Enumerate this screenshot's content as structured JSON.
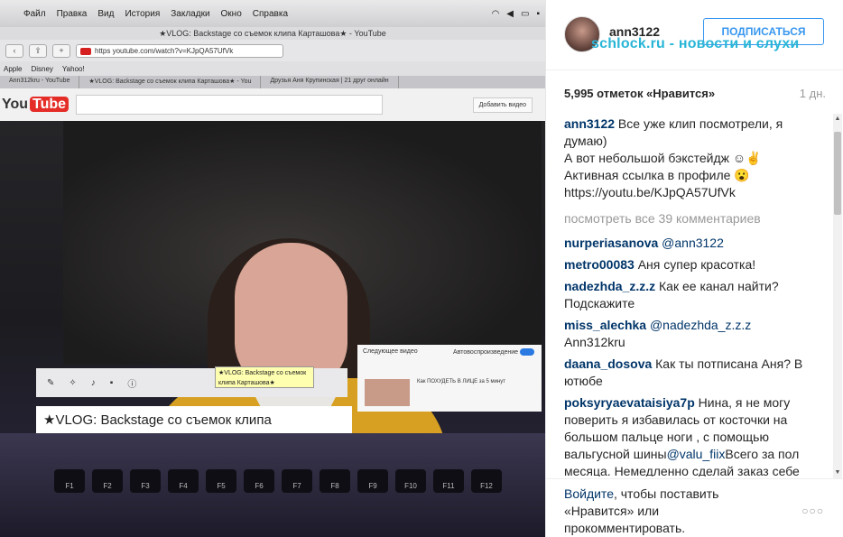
{
  "photo": {
    "menubar": [
      "Файл",
      "Правка",
      "Вид",
      "История",
      "Закладки",
      "Окно",
      "Справка"
    ],
    "window_title": "★VLOG: Backstage со съемок клипа Карташова★ - YouTube",
    "url": "https youtube.com/watch?v=KJpQA57UfVk",
    "bookmarks": [
      "Apple",
      "Disney",
      "Yahoo!"
    ],
    "tabs": [
      "Ann312kru - YouTube",
      "★VLOG: Backstage со съемок клипа Карташова★ - You",
      "Друзья Аня Крупинская | 21 друг онлайн"
    ],
    "yt_logo": "You",
    "yt_logo_tube": "Tube",
    "yt_add_video": "Добавить видео",
    "tooltip": "★VLOG: Backstage со съемок клипа Карташова★",
    "video_title": "★VLOG: Backstage со съемок клипа Карташова★",
    "next_label": "Следующее видео",
    "autoplay_label": "Автовоспроизведение",
    "next_video": "Как ПОХУДЕТЬ В ЛИЦЕ за 5 минут",
    "fkeys": [
      "F1",
      "F2",
      "F3",
      "F4",
      "F5",
      "F6",
      "F7",
      "F8",
      "F9",
      "F10",
      "F11",
      "F12"
    ]
  },
  "panel": {
    "username": "ann3122",
    "follow_label": "ПОДПИСАТЬСЯ",
    "watermark": "schlock.ru - новости и слухи",
    "likes": "5,995 отметок «Нравится»",
    "ago": "1 дн.",
    "caption": {
      "user": "ann3122",
      "line1": " Все уже клип посмотрели, я думаю)",
      "line2": "А вот небольшой бэкстейдж ☺✌",
      "line3": "Активная ссылка в профиле 😮",
      "line4": "https://youtu.be/KJpQA57UfVk"
    },
    "view_all": "посмотреть все 39 комментариев",
    "comments": [
      {
        "user": "nurperiasanova",
        "mention": "@ann3122",
        "text": ""
      },
      {
        "user": "metro00083",
        "mention": "",
        "text": " Аня супер красотка!"
      },
      {
        "user": "nadezhda_z.z.z",
        "mention": "",
        "text": " Как ее канал найти? Подскажите"
      },
      {
        "user": "miss_alechka",
        "mention": "@nadezhda_z.z.z",
        "text": " Ann312kru"
      },
      {
        "user": "daana_dosova",
        "mention": "",
        "text": " Как ты потписана Аня? В ютюбе"
      },
      {
        "user": "poksyryaevataisiya7p",
        "mention": "",
        "text": " Нина, я не могу поверить я избавилась от косточки на большом пальце ноги , с помощью вальгусной шины",
        "mention2": "@valu_fiix",
        "text2": "Всего за пол месяца. Немедленно сделай заказ себе"
      }
    ],
    "footer_link": "Войдите",
    "footer_text": ", чтобы поставить «Нравится» или прокомментировать.",
    "dots": "○○○"
  }
}
